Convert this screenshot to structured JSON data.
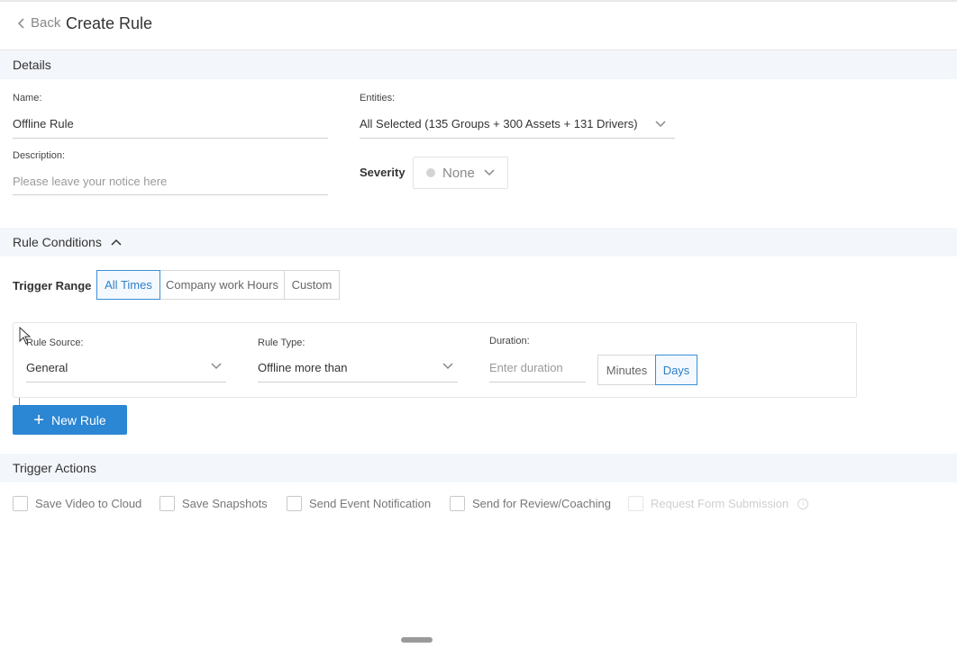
{
  "header": {
    "back_label": "Back",
    "title": "Create Rule"
  },
  "details": {
    "section_title": "Details",
    "name_label": "Name:",
    "name_value": "Offline Rule",
    "entities_label": "Entities:",
    "entities_value": "All Selected (135 Groups + 300 Assets + 131 Drivers)",
    "description_label": "Description:",
    "description_placeholder": "Please leave your notice here",
    "severity_label": "Severity",
    "severity_value": "None"
  },
  "conditions": {
    "section_title": "Rule Conditions",
    "trigger_range_label": "Trigger Range",
    "trigger_options": [
      "All Times",
      "Company work Hours",
      "Custom"
    ],
    "trigger_selected": "All Times",
    "rule_source_label": "Rule Source:",
    "rule_source_value": "General",
    "rule_type_label": "Rule Type:",
    "rule_type_value": "Offline more than",
    "duration_label": "Duration:",
    "duration_placeholder": "Enter duration",
    "duration_units": [
      "Minutes",
      "Days"
    ],
    "duration_unit_selected": "Days",
    "new_rule_label": "New Rule"
  },
  "actions": {
    "section_title": "Trigger Actions",
    "items": [
      {
        "label": "Save Video to Cloud",
        "checked": false,
        "disabled": false
      },
      {
        "label": "Save Snapshots",
        "checked": false,
        "disabled": false
      },
      {
        "label": "Send Event Notification",
        "checked": false,
        "disabled": false
      },
      {
        "label": "Send for Review/Coaching",
        "checked": false,
        "disabled": false
      },
      {
        "label": "Request Form Submission",
        "checked": false,
        "disabled": true
      }
    ]
  },
  "colors": {
    "accent": "#2b86d4",
    "section_bg": "#f3f6fa"
  }
}
